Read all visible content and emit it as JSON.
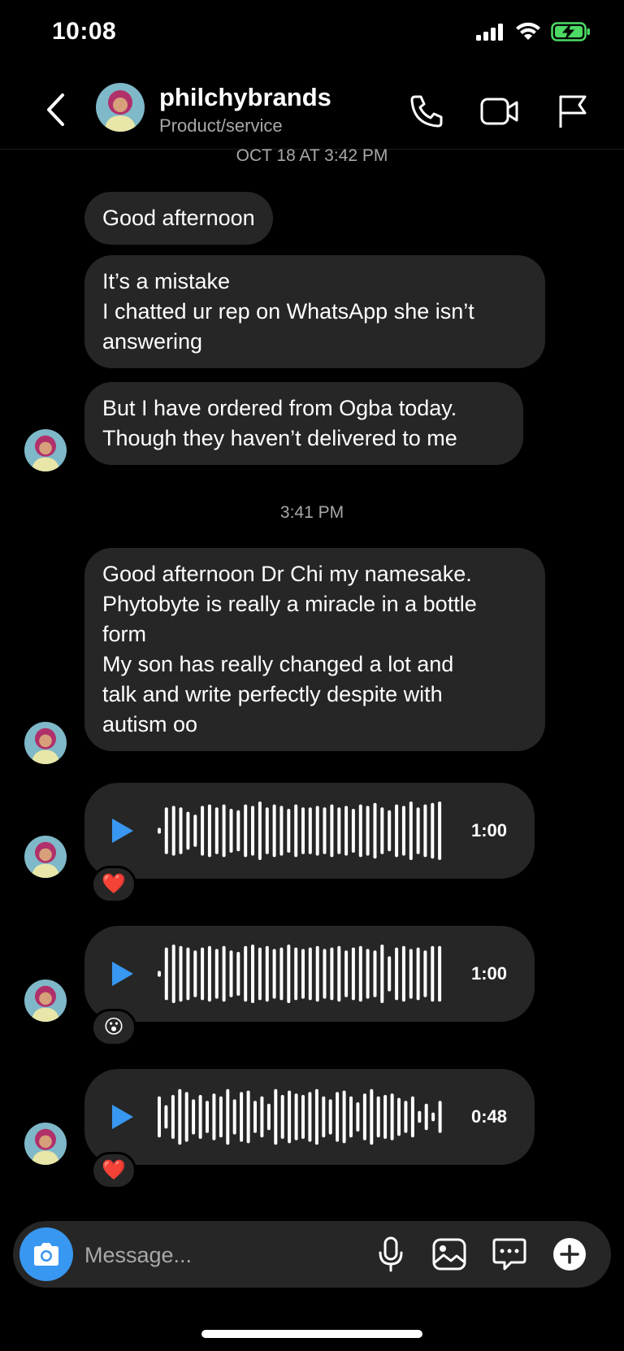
{
  "status_bar": {
    "time": "10:08"
  },
  "header": {
    "name": "philchybrands",
    "subtitle": "Product/service"
  },
  "thread": {
    "timestamp_1": "OCT 18 AT 3:42 PM",
    "messages_1": [
      {
        "lines": [
          "Good afternoon"
        ]
      },
      {
        "lines": [
          "It’s a mistake",
          "I chatted ur rep on WhatsApp she isn’t",
          "answering"
        ]
      },
      {
        "lines": [
          "But I have ordered from Ogba today.",
          "Though they haven’t delivered to me"
        ]
      }
    ],
    "timestamp_2": "3:41 PM",
    "messages_2": [
      {
        "lines": [
          "Good afternoon Dr Chi my namesake.",
          "Phytobyte is really a miracle in a bottle",
          "form",
          "My son has really changed a lot and",
          "talk and write perfectly despite with",
          "autism oo"
        ]
      }
    ],
    "voice_messages": [
      {
        "duration": "1:00",
        "reaction": "❤️",
        "reaction_name": "heart-reaction"
      },
      {
        "duration": "1:00",
        "reaction": "😮",
        "reaction_name": "surprised-face-reaction"
      },
      {
        "duration": "0:48",
        "reaction": "❤️",
        "reaction_name": "heart-reaction"
      }
    ]
  },
  "composer": {
    "placeholder": "Message..."
  },
  "colors": {
    "accent": "#3897f0",
    "bubble": "#262626",
    "background": "#000000",
    "battery": "#4cd964"
  },
  "icons": [
    "back-chevron-icon",
    "phone-icon",
    "video-camera-icon",
    "flag-icon",
    "play-icon",
    "camera-icon",
    "microphone-icon",
    "gallery-icon",
    "sticker-chat-icon",
    "plus-icon"
  ]
}
